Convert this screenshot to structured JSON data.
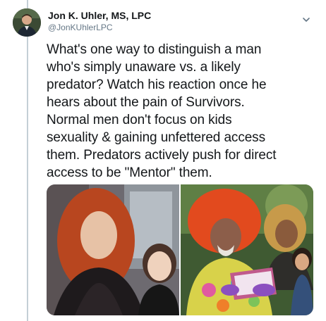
{
  "tweet": {
    "author_name": "Jon K. Uhler, MS, LPC",
    "author_handle": "@JonKUhlerLPC",
    "text": "What's one way to distinguish a man\nwho's simply unaware vs. a likely\npredator? Watch his reaction once he\nhears about the pain of Survivors.\nNormal men don't focus on kids\nsexuality & gaining unfettered access\nthem. Predators actively push for direct\naccess to be \"Mentor\" them."
  },
  "icons": {
    "menu": "chevron-down-icon",
    "avatar": "user-avatar"
  },
  "colors": {
    "text": "#14171a",
    "secondary": "#657786",
    "thread_line": "#c4cfd6"
  }
}
